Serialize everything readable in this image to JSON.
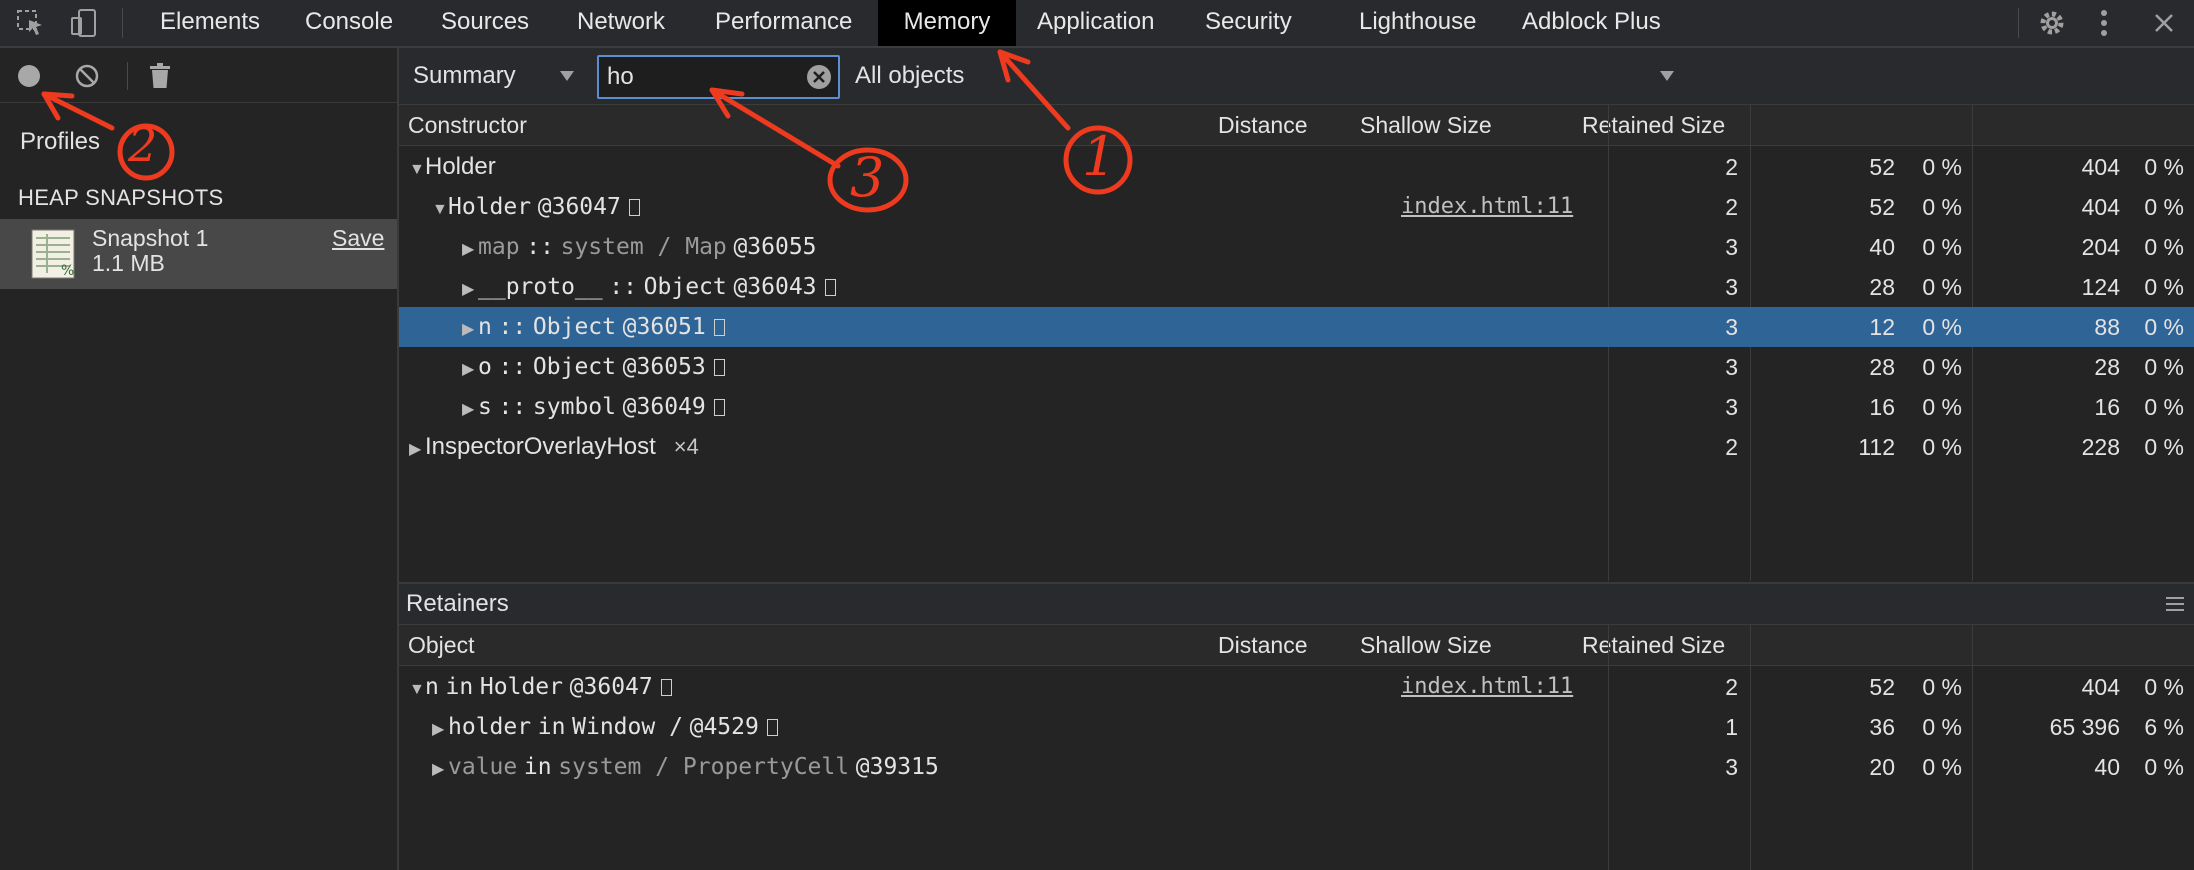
{
  "tabs": {
    "items": [
      "Elements",
      "Console",
      "Sources",
      "Network",
      "Performance",
      "Memory",
      "Application",
      "Security",
      "Lighthouse",
      "Adblock Plus"
    ],
    "active": "Memory"
  },
  "sidebar": {
    "profiles_label": "Profiles",
    "section_title": "HEAP SNAPSHOTS",
    "snapshot": {
      "name": "Snapshot 1",
      "size": "1.1 MB",
      "save_label": "Save"
    }
  },
  "filter": {
    "view": "Summary",
    "search_value": "ho",
    "object_filter": "All objects"
  },
  "summary_grid": {
    "headers": {
      "constructor": "Constructor",
      "distance": "Distance",
      "shallow": "Shallow Size",
      "retained": "Retained Size"
    },
    "rows": [
      {
        "name": "Holder",
        "distance": "2",
        "shallow": "52",
        "shallow_pct": "0 %",
        "retained": "404",
        "retained_pct": "0 %"
      },
      {
        "name": "Holder",
        "id": "@36047",
        "link": "index.html:11",
        "distance": "2",
        "shallow": "52",
        "shallow_pct": "0 %",
        "retained": "404",
        "retained_pct": "0 %"
      },
      {
        "prop": "map",
        "sep": "::",
        "type": "system / Map",
        "id": "@36055",
        "distance": "3",
        "shallow": "40",
        "shallow_pct": "0 %",
        "retained": "204",
        "retained_pct": "0 %"
      },
      {
        "prop": "__proto__",
        "sep": "::",
        "type": "Object",
        "id": "@36043",
        "distance": "3",
        "shallow": "28",
        "shallow_pct": "0 %",
        "retained": "124",
        "retained_pct": "0 %"
      },
      {
        "prop": "n",
        "sep": "::",
        "type": "Object",
        "id": "@36051",
        "distance": "3",
        "shallow": "12",
        "shallow_pct": "0 %",
        "retained": "88",
        "retained_pct": "0 %"
      },
      {
        "prop": "o",
        "sep": "::",
        "type": "Object",
        "id": "@36053",
        "distance": "3",
        "shallow": "28",
        "shallow_pct": "0 %",
        "retained": "28",
        "retained_pct": "0 %"
      },
      {
        "prop": "s",
        "sep": "::",
        "type": "symbol",
        "id": "@36049",
        "distance": "3",
        "shallow": "16",
        "shallow_pct": "0 %",
        "retained": "16",
        "retained_pct": "0 %"
      },
      {
        "name": "InspectorOverlayHost",
        "count": "×4",
        "distance": "2",
        "shallow": "112",
        "shallow_pct": "0 %",
        "retained": "228",
        "retained_pct": "0 %"
      }
    ]
  },
  "retainers": {
    "title": "Retainers",
    "headers": {
      "object": "Object",
      "distance": "Distance",
      "shallow": "Shallow Size",
      "retained": "Retained Size"
    },
    "rows": [
      {
        "prop": "n",
        "in": "in",
        "owner": "Holder",
        "id": "@36047",
        "link": "index.html:11",
        "distance": "2",
        "shallow": "52",
        "shallow_pct": "0 %",
        "retained": "404",
        "retained_pct": "0 %"
      },
      {
        "prop": "holder",
        "in": "in",
        "owner": "Window /",
        "id": "@4529",
        "distance": "1",
        "shallow": "36",
        "shallow_pct": "0 %",
        "retained": "65 396",
        "retained_pct": "6 %"
      },
      {
        "prop": "value",
        "in": "in",
        "owner": "system / PropertyCell",
        "id": "@39315",
        "distance": "3",
        "shallow": "20",
        "shallow_pct": "0 %",
        "retained": "40",
        "retained_pct": "0 %"
      }
    ]
  },
  "annotations": [
    "1",
    "2",
    "3"
  ],
  "colors": {
    "selection": "#2f6497",
    "annotation": "#ee3b1f",
    "background": "#242424"
  }
}
